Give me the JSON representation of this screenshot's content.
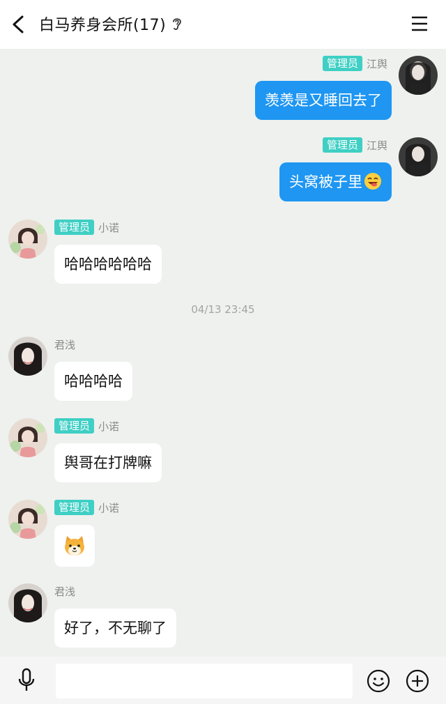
{
  "header": {
    "title": "白马养身会所(17)",
    "back_icon": "chevron-left-icon",
    "ear_icon": "ear-icon",
    "menu_icon": "menu-icon"
  },
  "messages": [
    {
      "side": "right",
      "badge": "管理员",
      "sender": "江舆",
      "text": "羡羡是又睡回去了"
    },
    {
      "side": "right",
      "badge": "管理员",
      "sender": "江舆",
      "text": "头窝被子里"
    },
    {
      "side": "left",
      "badge": "管理员",
      "sender": "小诺",
      "text": "哈哈哈哈哈哈"
    },
    {
      "timestamp": "04/13 23:45"
    },
    {
      "side": "left",
      "sender": "君浅",
      "text": "哈哈哈哈"
    },
    {
      "side": "left",
      "badge": "管理员",
      "sender": "小诺",
      "text": "舆哥在打牌嘛"
    },
    {
      "side": "left",
      "badge": "管理员",
      "sender": "小诺",
      "sticker": "dog-emoji-icon"
    },
    {
      "side": "left",
      "sender": "君浅",
      "text": "好了，不无聊了"
    }
  ],
  "bottom_bar": {
    "mic_icon": "microphone-icon",
    "emoji_icon": "smiley-icon",
    "plus_icon": "plus-circle-icon",
    "input_value": ""
  },
  "colors": {
    "background": "#eef1ee",
    "right_bubble": "#1e96f2",
    "badge": "#3fcfc4"
  }
}
